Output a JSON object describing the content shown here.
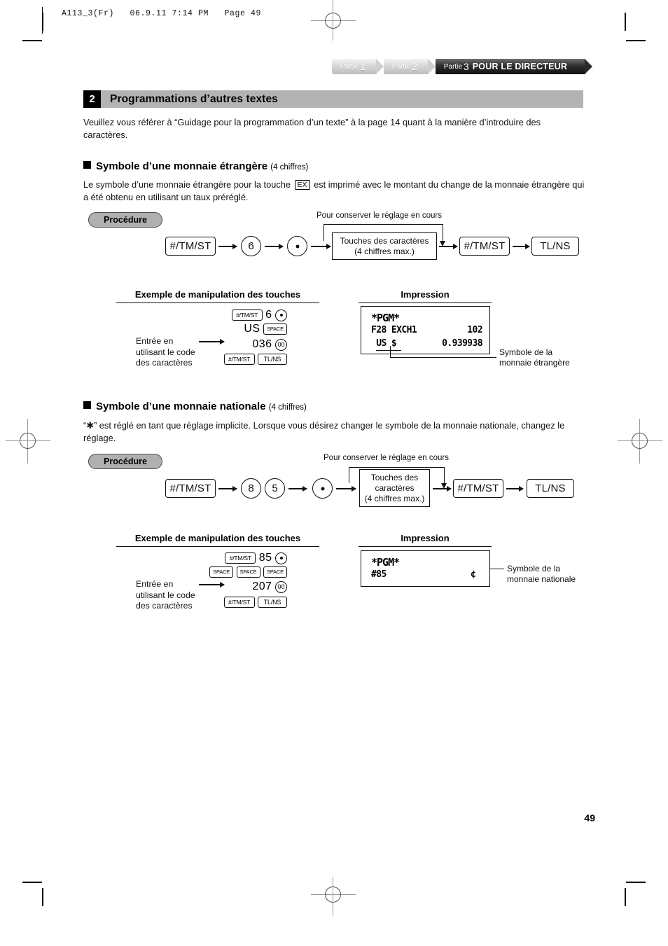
{
  "page": {
    "file_header": "A113_3(Fr)   06.9.11 7:14 PM   Page 49",
    "page_number": "49"
  },
  "tabs": [
    {
      "label": "Partie",
      "num": "1",
      "title": "",
      "state": "inactive"
    },
    {
      "label": "Partie",
      "num": "2",
      "title": "",
      "state": "inactive"
    },
    {
      "label": "Partie",
      "num": "3",
      "title": "POUR LE DIRECTEUR",
      "state": "active"
    }
  ],
  "section": {
    "number": "2",
    "title": "Programmations d’autres textes",
    "intro": "Veuillez vous référer à “Guidage pour la programmation d’un texte” à la page 14 quant à la manière d’introduire des caractères."
  },
  "subsections": [
    {
      "heading": "Symbole d’une monnaie étrangère",
      "qty": "(4 chiffres)",
      "body_before": "Le symbole d’une monnaie étrangère pour la touche",
      "inline_key": "EX",
      "body_after": "est imprimé avec le montant du change de la monnaie étrangère qui a été obtenu en utilisant un taux préréglé.",
      "procedure": {
        "pill": "Procédure",
        "bypass_label": "Pour conserver le réglage en cours",
        "steps": [
          {
            "type": "keybox",
            "label": "#/TM/ST"
          },
          {
            "type": "circle",
            "label": "6"
          },
          {
            "type": "dot",
            "label": ""
          },
          {
            "type": "charbox",
            "lines": [
              "Touches des caractères",
              "(4 chiffres max.)"
            ]
          },
          {
            "type": "keybox",
            "label": "#/TM/ST"
          },
          {
            "type": "keybox",
            "label": "TL/NS"
          }
        ]
      },
      "example": {
        "heading": "Exemple de manipulation des touches",
        "note": "Entrée en utilisant le code des caractères",
        "rows": [
          [
            {
              "k": "cap",
              "t": "#/TM/ST"
            },
            {
              "k": "num",
              "t": "6"
            },
            {
              "k": "dot",
              "t": ""
            }
          ],
          [
            {
              "k": "num",
              "t": "US"
            },
            {
              "k": "space",
              "t": "SPACE"
            }
          ],
          [
            {
              "k": "num",
              "t": "036"
            },
            {
              "k": "round",
              "t": "00"
            }
          ],
          [
            {
              "k": "cap",
              "t": "#/TM/ST"
            },
            {
              "k": "tl",
              "t": "TL/NS"
            }
          ]
        ]
      },
      "print": {
        "heading": "Impression",
        "lines": [
          "*PGM*",
          "F28 EXCH1          102",
          " US $         0.939938"
        ],
        "callout": "Symbole de la monnaie étrangère"
      }
    },
    {
      "heading": "Symbole d’une monnaie nationale",
      "qty": "(4 chiffres)",
      "body": "“✱” est  réglé en tant que réglage implicite. Lorsque vous désirez changer le symbole de la monnaie nationale, changez le réglage.",
      "procedure": {
        "pill": "Procédure",
        "bypass_label": "Pour conserver le réglage en cours",
        "steps": [
          {
            "type": "keybox",
            "label": "#/TM/ST"
          },
          {
            "type": "circle",
            "label": "8"
          },
          {
            "type": "circle",
            "label": "5"
          },
          {
            "type": "dot",
            "label": ""
          },
          {
            "type": "charbox",
            "lines": [
              "Touches des",
              "caractères",
              "(4 chiffres max.)"
            ]
          },
          {
            "type": "keybox",
            "label": "#/TM/ST"
          },
          {
            "type": "keybox",
            "label": "TL/NS"
          }
        ]
      },
      "example": {
        "heading": "Exemple de manipulation des touches",
        "note": "Entrée en utilisant le code des caractères",
        "rows": [
          [
            {
              "k": "cap",
              "t": "#/TM/ST"
            },
            {
              "k": "num",
              "t": "85"
            },
            {
              "k": "dot",
              "t": ""
            }
          ],
          [
            {
              "k": "space",
              "t": "SPACE"
            },
            {
              "k": "space",
              "t": "SPACE"
            },
            {
              "k": "space",
              "t": "SPACE"
            }
          ],
          [
            {
              "k": "num",
              "t": "207"
            },
            {
              "k": "round",
              "t": "00"
            }
          ],
          [
            {
              "k": "cap",
              "t": "#/TM/ST"
            },
            {
              "k": "tl",
              "t": "TL/NS"
            }
          ]
        ]
      },
      "print": {
        "heading": "Impression",
        "lines": [
          "*PGM*",
          "#85",
          "¢"
        ],
        "callout": "Symbole de la monnaie nationale"
      }
    }
  ]
}
